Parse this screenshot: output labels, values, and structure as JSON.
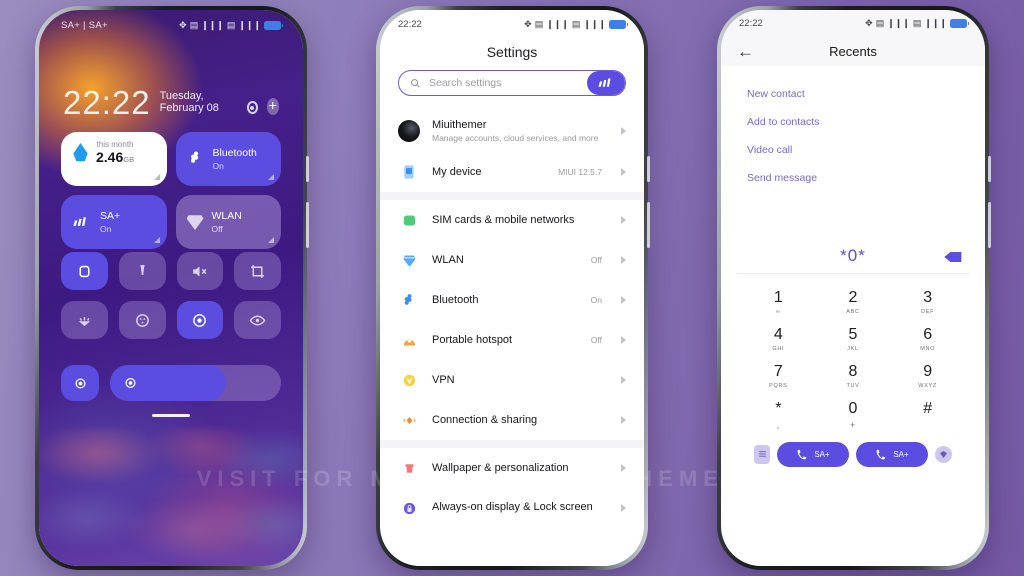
{
  "watermark": {
    "part1": "VISIT FOR MORE",
    "part2": "MIUITHEMER.COM"
  },
  "theme": {
    "accent": "#5b4de0",
    "bg_left": "#9a8cc0",
    "bg_right": "#7459a4",
    "link": "#7a69c9"
  },
  "phone1": {
    "status": {
      "carriers": "SA+ | SA+",
      "icons": [
        "bluetooth-icon",
        "sim1-icon",
        "signal1-icon",
        "sim2-icon",
        "signal2-icon",
        "battery-icon"
      ]
    },
    "clock": "22:22",
    "date": "Tuesday, February 08",
    "big_tiles": [
      {
        "kind": "data-usage",
        "icon": "water-drop-icon",
        "top_label": "this month",
        "value": "2.46",
        "unit": "GB",
        "style": "light"
      },
      {
        "kind": "bluetooth",
        "icon": "bluetooth-icon",
        "label": "Bluetooth",
        "sub": "On",
        "style": "blue"
      },
      {
        "kind": "mobile-data",
        "icon": "signal-bars-icon",
        "label": "SA+",
        "sub": "On",
        "style": "blue"
      },
      {
        "kind": "wlan",
        "icon": "wifi-shield-icon",
        "label": "WLAN",
        "sub": "Off",
        "style": "dim"
      }
    ],
    "quick_tiles": [
      {
        "icon": "screen-rotation-icon",
        "on": true
      },
      {
        "icon": "flashlight-icon",
        "on": false
      },
      {
        "icon": "mute-icon",
        "on": false
      },
      {
        "icon": "screenshot-icon",
        "on": false
      },
      {
        "icon": "auto-brightness-icon",
        "on": false
      },
      {
        "icon": "reading-mode-icon",
        "on": false
      },
      {
        "icon": "location-icon",
        "on": true
      },
      {
        "icon": "eye-care-icon",
        "on": false
      }
    ],
    "slider": {
      "icon_left": "brightness-low-icon",
      "icon_slider": "brightness-icon",
      "value_percent": 68
    }
  },
  "phone2": {
    "status": {
      "time": "22:22"
    },
    "title": "Settings",
    "search": {
      "placeholder": "Search settings",
      "icon": "search-icon",
      "logo": "miui-logo-icon"
    },
    "account": {
      "name": "Miuithemer",
      "desc": "Manage accounts, cloud services, and more",
      "avatar": "user-avatar"
    },
    "device": {
      "name": "My device",
      "value": "MIUI 12.5.7",
      "icon": "phone-icon"
    },
    "rows": [
      {
        "name": "SIM cards & mobile networks",
        "value": "",
        "icon": "sim-card-icon",
        "color": "#4fca77"
      },
      {
        "name": "WLAN",
        "value": "Off",
        "icon": "wifi-shield-icon",
        "color": "#57a9f5"
      },
      {
        "name": "Bluetooth",
        "value": "On",
        "icon": "bluetooth-icon",
        "color": "#3d8ef0"
      },
      {
        "name": "Portable hotspot",
        "value": "Off",
        "icon": "hotspot-icon",
        "color": "#f3a33b"
      },
      {
        "name": "VPN",
        "value": "",
        "icon": "vpn-shield-icon",
        "color": "#f0d340"
      },
      {
        "name": "Connection & sharing",
        "value": "",
        "icon": "sharing-icon",
        "color": "#f08a22"
      }
    ],
    "rows2": [
      {
        "name": "Wallpaper & personalization",
        "value": "",
        "icon": "wallpaper-shirt-icon",
        "color": "#ef7a79"
      },
      {
        "name": "Always-on display & Lock screen",
        "value": "",
        "icon": "lock-icon",
        "color": "#6a58dd"
      }
    ]
  },
  "phone3": {
    "status": {
      "time": "22:22"
    },
    "title": "Recents",
    "back_icon": "back-arrow-icon",
    "options": [
      "New contact",
      "Add to contacts",
      "Video call",
      "Send message"
    ],
    "dialed_number": "*0*",
    "delete_icon": "backspace-icon",
    "keypad": [
      {
        "num": "1",
        "letters": "∞"
      },
      {
        "num": "2",
        "letters": "ABC"
      },
      {
        "num": "3",
        "letters": "DEF"
      },
      {
        "num": "4",
        "letters": "GHI"
      },
      {
        "num": "5",
        "letters": "JKL"
      },
      {
        "num": "6",
        "letters": "MNO"
      },
      {
        "num": "7",
        "letters": "PQRS"
      },
      {
        "num": "8",
        "letters": "TUV"
      },
      {
        "num": "9",
        "letters": "WXYZ"
      },
      {
        "num": "*",
        "letters": ","
      },
      {
        "num": "0",
        "letters": "+"
      },
      {
        "num": "#",
        "letters": ""
      }
    ],
    "actions": {
      "keypad_toggle_icon": "dialpad-list-icon",
      "call1_label": "SA+",
      "call2_label": "SA+",
      "call_icon": "phone-call-icon",
      "more_icon": "contacts-icon"
    }
  }
}
